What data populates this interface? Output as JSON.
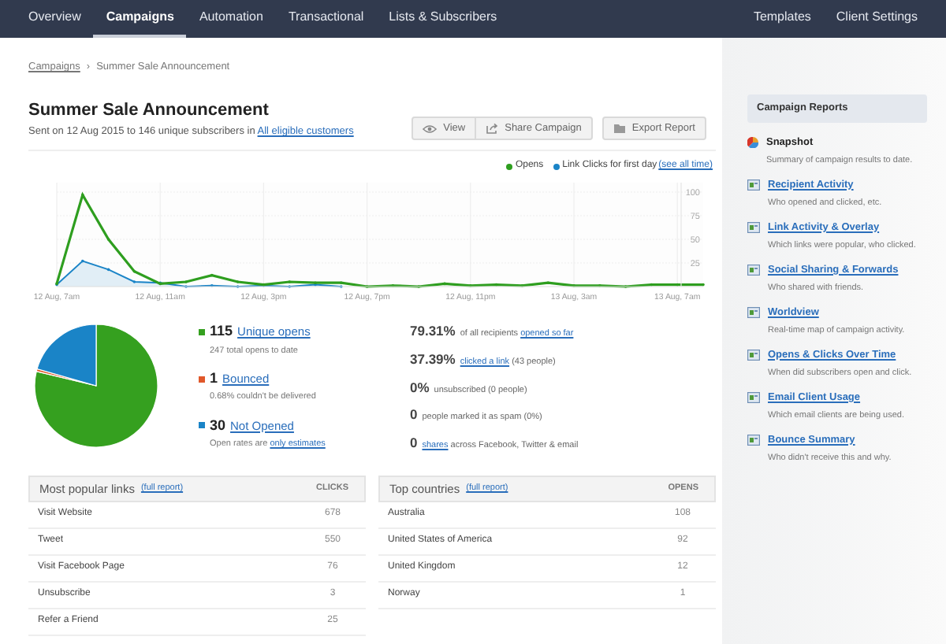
{
  "nav": {
    "left": [
      {
        "label": "Overview",
        "selected": false
      },
      {
        "label": "Campaigns",
        "selected": true
      },
      {
        "label": "Automation",
        "selected": false
      },
      {
        "label": "Transactional",
        "selected": false
      },
      {
        "label": "Lists & Subscribers",
        "selected": false
      }
    ],
    "right": [
      {
        "label": "Templates",
        "selected": false
      },
      {
        "label": "Client Settings",
        "selected": false
      }
    ]
  },
  "breadcrumb": {
    "link": "Campaigns",
    "separator": "›",
    "current": "Summer Sale Announcement"
  },
  "title": "Summer Sale Announcement",
  "subtitle": {
    "text": "Sent on 12 Aug 2015 to 146 unique subscribers in",
    "link": "All eligible customers"
  },
  "buttons": [
    {
      "label": "View",
      "kind": "view"
    },
    {
      "label": "Share Campaign",
      "kind": "share"
    },
    {
      "label": "Export Report",
      "kind": "export"
    }
  ],
  "legend_link": "(see all time)",
  "line_chart": {
    "chart_data": {
      "type": "line",
      "categories": [
        "12 Aug, 7am",
        null,
        null,
        null,
        "12 Aug, 11am",
        null,
        null,
        null,
        "12 Aug, 3pm",
        null,
        null,
        null,
        "12 Aug, 7pm",
        null,
        null,
        null,
        "12 Aug, 11pm",
        null,
        null,
        null,
        "13 Aug, 3am",
        null,
        null,
        null,
        "13 Aug, 7am",
        null
      ],
      "yticks": [
        25,
        50,
        75,
        100
      ],
      "ylim": [
        0,
        110
      ],
      "grid": true,
      "series": [
        {
          "name": "Opens",
          "color": "#2e9e1f",
          "values": [
            3,
            97,
            50,
            16,
            3,
            5,
            12,
            5,
            2,
            5,
            4,
            4,
            0,
            1,
            0,
            3,
            1,
            2,
            1,
            4,
            1,
            1,
            0,
            2,
            2,
            2
          ]
        },
        {
          "name": "Link Clicks for first day",
          "color": "#1a84c7",
          "values": [
            2,
            27,
            18,
            5,
            4,
            0,
            1,
            0,
            1,
            0,
            2,
            0,
            null,
            null,
            null,
            null,
            null,
            null,
            null,
            null,
            null,
            null,
            null,
            null,
            null,
            null
          ]
        }
      ]
    }
  },
  "pie": {
    "chart_data": {
      "type": "pie",
      "values": [
        78.77,
        0.68,
        20.55
      ]
    }
  },
  "stats": [
    {
      "color": "#35a01f",
      "value": "115",
      "link": "Unique opens",
      "sub": [
        {
          "text": "247 total opens to date",
          "link": false
        }
      ]
    },
    {
      "color": "#e0582a",
      "value": "1",
      "link": "Bounced",
      "sub": [
        {
          "text": "0.68% couldn't be delivered",
          "link": false
        }
      ]
    },
    {
      "color": "#1a84c7",
      "value": "30",
      "link": "Not Opened",
      "sub": [
        {
          "text": "Open rates are",
          "link": false
        },
        {
          "text": "only estimates",
          "link": true
        }
      ]
    }
  ],
  "summary": [
    {
      "value": "79.31%",
      "parts": [
        {
          "text": "of all recipients",
          "link": false
        },
        {
          "text": "opened so far",
          "link": true
        }
      ]
    },
    {
      "value": "37.39%",
      "parts": [
        {
          "text": "clicked a link",
          "link": true
        },
        {
          "text": "(43 people)",
          "link": false
        }
      ]
    },
    {
      "value": "0%",
      "parts": [
        {
          "text": "unsubscribed (0 people)",
          "link": false
        }
      ]
    },
    {
      "value": "0",
      "parts": [
        {
          "text": "people marked it as spam (0%)",
          "link": false
        }
      ]
    },
    {
      "value": "0",
      "parts": [
        {
          "text": "shares",
          "link": true
        },
        {
          "text": "across Facebook, Twitter & email",
          "link": false
        }
      ]
    }
  ],
  "tables": [
    {
      "title": "Most popular links",
      "link": "(full report)",
      "column": "CLICKS",
      "rows": [
        {
          "label": "Visit Website",
          "value": "678"
        },
        {
          "label": "Tweet",
          "value": "550"
        },
        {
          "label": "Visit Facebook Page",
          "value": "76"
        },
        {
          "label": "Unsubscribe",
          "value": "3"
        },
        {
          "label": "Refer a Friend",
          "value": "25"
        }
      ]
    },
    {
      "title": "Top countries",
      "link": "(full report)",
      "column": "OPENS",
      "rows": [
        {
          "label": "Australia",
          "value": "108"
        },
        {
          "label": "United States of America",
          "value": "92"
        },
        {
          "label": "United Kingdom",
          "value": "12"
        },
        {
          "label": "Norway",
          "value": "1"
        }
      ]
    }
  ],
  "sidebar": {
    "title": "Campaign Reports",
    "items": [
      {
        "label": "Snapshot",
        "description": "Summary of campaign results to date.",
        "selected": true
      },
      {
        "label": "Recipient Activity",
        "description": "Who opened and clicked, etc.",
        "selected": false
      },
      {
        "label": "Link Activity & Overlay",
        "description": "Which links were popular, who clicked.",
        "selected": false
      },
      {
        "label": "Social Sharing & Forwards",
        "description": "Who shared with friends.",
        "selected": false
      },
      {
        "label": "Worldview",
        "description": "Real-time map of campaign activity.",
        "selected": false
      },
      {
        "label": "Opens & Clicks Over Time",
        "description": "When did subscribers open and click.",
        "selected": false
      },
      {
        "label": "Email Client Usage",
        "description": "Which email clients are being used.",
        "selected": false
      },
      {
        "label": "Bounce Summary",
        "description": "Who didn't receive this and why.",
        "selected": false
      }
    ]
  }
}
